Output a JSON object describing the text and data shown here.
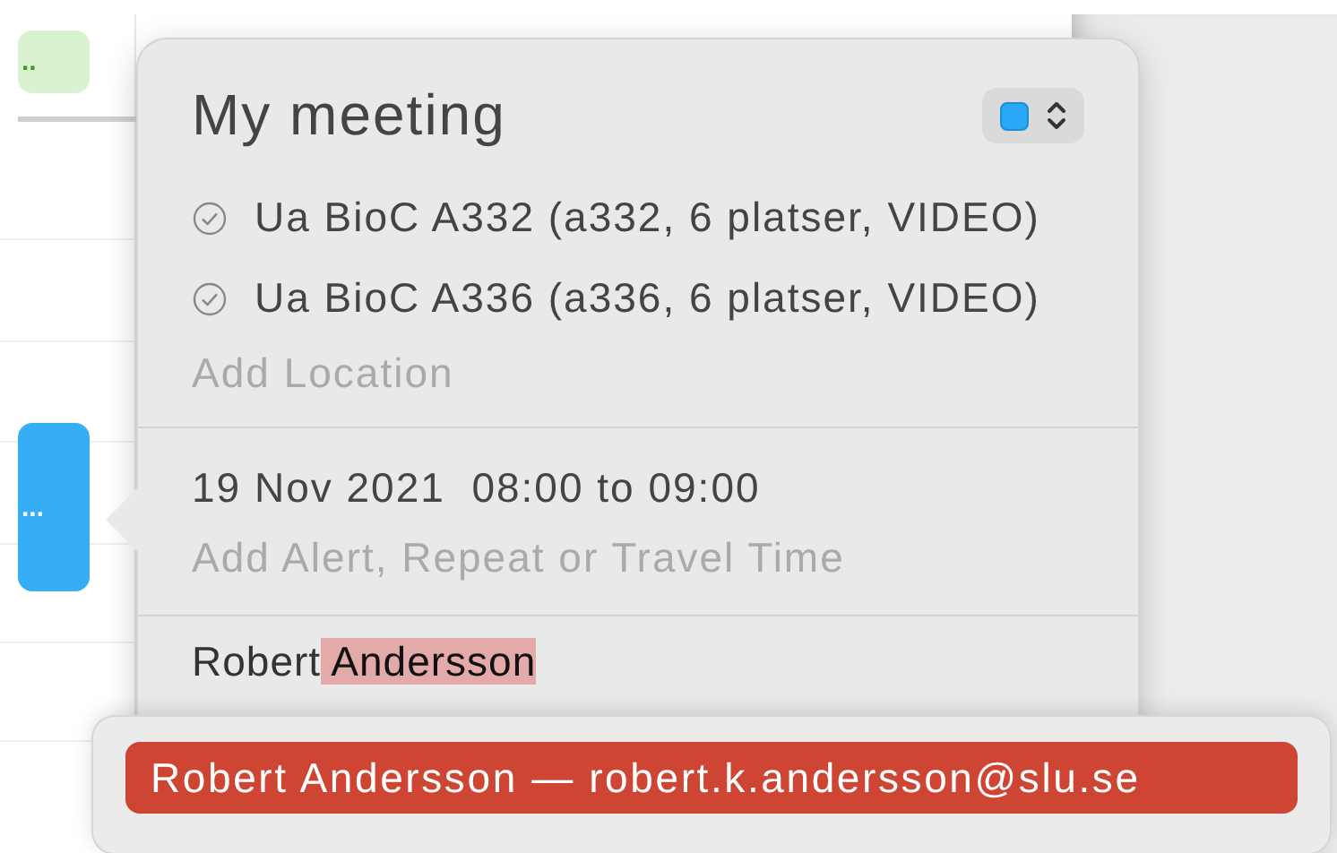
{
  "calendar": {
    "events": [
      {
        "text": "..",
        "color": "#d9f2cf"
      },
      {
        "text": "...",
        "color": "#35aef5"
      }
    ]
  },
  "popover": {
    "title": "My meeting",
    "calendar_picker": {
      "color": "#2aa8f5"
    },
    "locations": [
      {
        "name": "Ua BioC A332 (a332, 6 platser, VIDEO)",
        "confirmed": true
      },
      {
        "name": "Ua BioC A336 (a336, 6 platser, VIDEO)",
        "confirmed": true
      }
    ],
    "location_placeholder": "Add Location",
    "date": "19 Nov 2021  08:00 to 09:00",
    "details_placeholder": "Add Alert, Repeat or Travel Time",
    "attendee_field": {
      "typed": "Robert",
      "completion": "Andersson"
    }
  },
  "suggestions": [
    {
      "text": "Robert Andersson — robert.k.andersson@slu.se",
      "selected": true
    }
  ]
}
